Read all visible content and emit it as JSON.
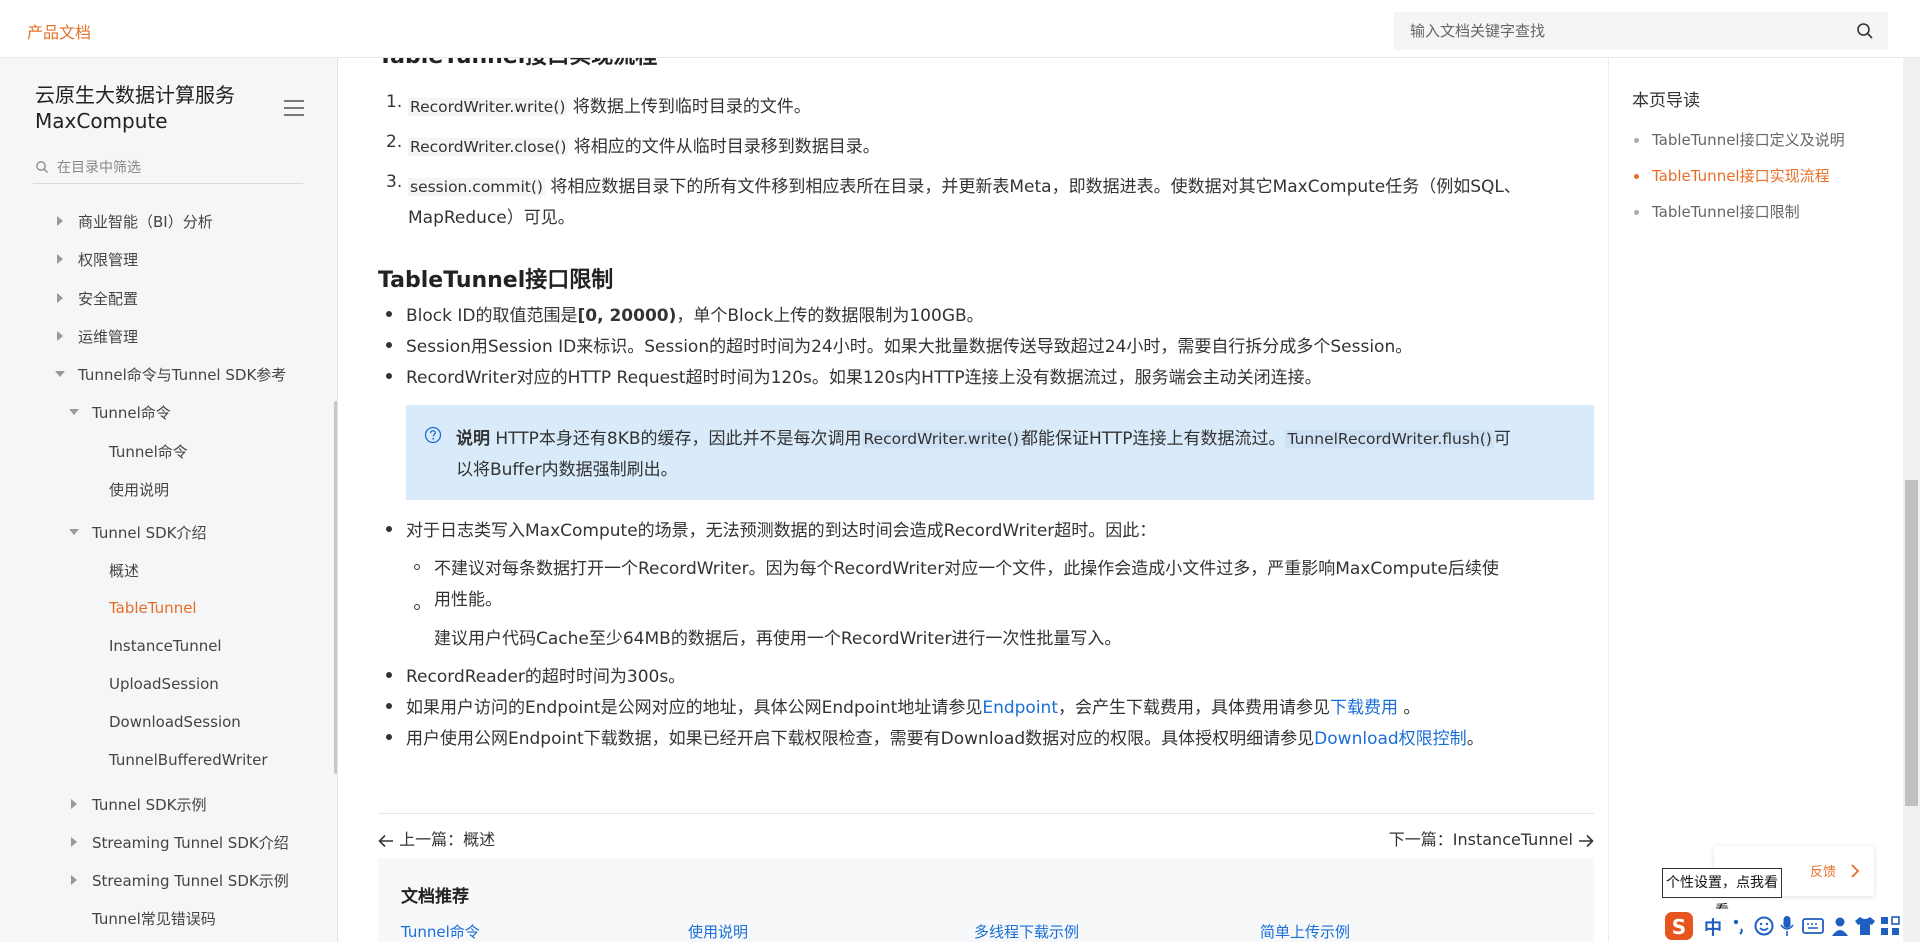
{
  "header": {
    "brand": "产品文档",
    "search_placeholder": "输入文档关键字查找"
  },
  "sidebar": {
    "title_line1": "云原生大数据计算服务",
    "title_line2": "MaxCompute",
    "filter_placeholder": "在目录中筛选",
    "items": [
      {
        "label": "商业智能（BI）分析"
      },
      {
        "label": "权限管理"
      },
      {
        "label": "安全配置"
      },
      {
        "label": "运维管理"
      },
      {
        "label": "Tunnel命令与Tunnel SDK参考"
      },
      {
        "label": "Tunnel命令"
      },
      {
        "label": "Tunnel命令"
      },
      {
        "label": "使用说明"
      },
      {
        "label": "Tunnel SDK介绍"
      },
      {
        "label": "概述"
      },
      {
        "label": "TableTunnel"
      },
      {
        "label": "InstanceTunnel"
      },
      {
        "label": "UploadSession"
      },
      {
        "label": "DownloadSession"
      },
      {
        "label": "TunnelBufferedWriter"
      },
      {
        "label": "Tunnel SDK示例"
      },
      {
        "label": "Streaming Tunnel SDK介绍"
      },
      {
        "label": "Streaming Tunnel SDK示例"
      },
      {
        "label": "Tunnel常见错误码"
      }
    ]
  },
  "content": {
    "cut_heading": "TableTunnel接口实现流程",
    "steps": [
      {
        "num": "1.",
        "code": "RecordWriter.write()",
        "text": " 将数据上传到临时目录的文件。"
      },
      {
        "num": "2.",
        "code": "RecordWriter.close()",
        "text": " 将相应的文件从临时目录移到数据目录。"
      },
      {
        "num": "3.",
        "code": "session.commit()",
        "text": " 将相应数据目录下的所有文件移到相应表所在目录，并更新表Meta，即数据进表。使数据对其它MaxCompute任务（例如SQL、",
        "text2": "MapReduce）可见。"
      }
    ],
    "h2": "TableTunnel接口限制",
    "limits": {
      "b1_pre": "Block ID的取值范围是",
      "b1_bold": "[0, 20000)",
      "b1_post": "，单个Block上传的数据限制为100GB。",
      "b2": "Session用Session ID来标识。Session的超时时间为24小时。如果大批量数据传送导致超过24小时，需要自行拆分成多个Session。",
      "b3": "RecordWriter对应的HTTP Request超时时间为120s。如果120s内HTTP连接上没有数据流过，服务端会主动关闭连接。"
    },
    "note": {
      "label": "说明",
      "t1": " HTTP本身还有8KB的缓存，因此并不是每次调用",
      "code1": "RecordWriter.write()",
      "t2": "都能保证HTTP连接上有数据流过。",
      "code2": "TunnelRecordWriter.flush()",
      "t3": "可",
      "line2": "以将Buffer内数据强制刷出。"
    },
    "log": {
      "intro": "对于日志类写入MaxCompute的场景，无法预测数据的到达时间会造成RecordWriter超时。因此：",
      "s1": "不建议对每条数据打开一个RecordWriter。因为每个RecordWriter对应一个文件，此操作会造成小文件过多，严重影响MaxCompute后续使",
      "s1b": "用性能。",
      "s2": "建议用户代码Cache至少64MB的数据后，再使用一个RecordWriter进行一次性批量写入。"
    },
    "b4": "RecordReader的超时时间为300s。",
    "b5_pre": "如果用户访问的Endpoint是公网对应的地址，具体公网Endpoint地址请参见",
    "b5_link1": "Endpoint",
    "b5_mid": "，会产生下载费用，具体费用请参见",
    "b5_link2": "下载费用",
    "b5_post": " 。",
    "b6_pre": "用户使用公网Endpoint下载数据，如果已经开启下载权限检查，需要有Download数据对应的权限。具体授权明细请参见",
    "b6_link": "Download权限控制",
    "b6_post": "。"
  },
  "pager": {
    "prev": "上一篇：概述",
    "next": "下一篇：InstanceTunnel"
  },
  "recommend": {
    "title": "文档推荐",
    "links": [
      "Tunnel命令",
      "使用说明",
      "多线程下载示例",
      "简单上传示例"
    ]
  },
  "toc": {
    "title": "本页导读",
    "items": [
      "TableTunnel接口定义及说明",
      "TableTunnel接口实现流程",
      "TableTunnel接口限制"
    ]
  },
  "widget": {
    "tooltip": "个性设置，点我看看",
    "ime_label": "中",
    "float_text": "反馈"
  },
  "colors": {
    "accent": "#e66f27",
    "link": "#1a6ed8",
    "note_bg": "#d9ebfa"
  }
}
